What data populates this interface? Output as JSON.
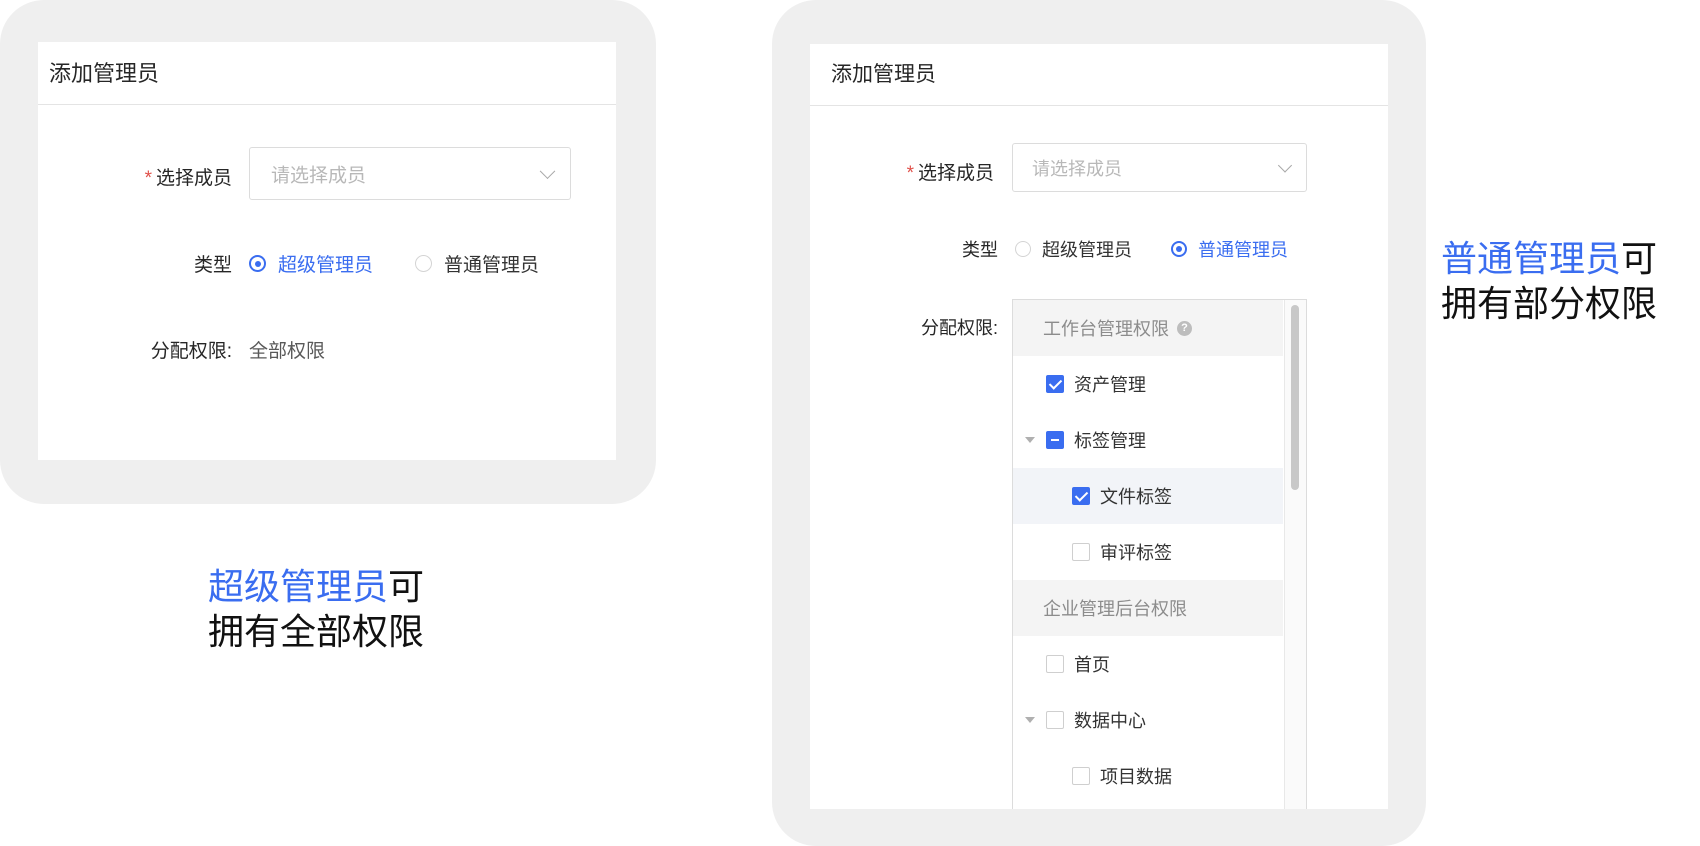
{
  "left_panel": {
    "title": "添加管理员",
    "member": {
      "required_mark": "*",
      "label": "选择成员",
      "placeholder": "请选择成员"
    },
    "type": {
      "label": "类型",
      "options": [
        {
          "label": "超级管理员",
          "selected": true
        },
        {
          "label": "普通管理员",
          "selected": false
        }
      ]
    },
    "permissions": {
      "label": "分配权限:",
      "value": "全部权限"
    }
  },
  "right_panel": {
    "title": "添加管理员",
    "member": {
      "required_mark": "*",
      "label": "选择成员",
      "placeholder": "请选择成员"
    },
    "type": {
      "label": "类型",
      "options": [
        {
          "label": "超级管理员",
          "selected": false
        },
        {
          "label": "普通管理员",
          "selected": true
        }
      ]
    },
    "permissions": {
      "label": "分配权限:",
      "tree": [
        {
          "label": "工作台管理权限",
          "kind": "group",
          "help": "?"
        },
        {
          "label": "资产管理",
          "state": "checked"
        },
        {
          "label": "标签管理",
          "state": "indeterminate",
          "expanded": true
        },
        {
          "label": "文件标签",
          "state": "checked"
        },
        {
          "label": "审评标签",
          "state": "unchecked"
        },
        {
          "label": "企业管理后台权限",
          "kind": "group"
        },
        {
          "label": "首页",
          "state": "unchecked"
        },
        {
          "label": "数据中心",
          "state": "unchecked",
          "expanded": true
        },
        {
          "label": "项目数据",
          "state": "unchecked"
        }
      ]
    }
  },
  "captions": {
    "left": {
      "accent": "超级管理员",
      "rest1": "可",
      "line2": "拥有全部权限"
    },
    "right": {
      "accent": "普通管理员",
      "rest1": "可",
      "line2": "拥有部分权限"
    }
  },
  "colors": {
    "accent": "#3a6df0",
    "required": "#e0504a",
    "frame": "#efefef"
  }
}
